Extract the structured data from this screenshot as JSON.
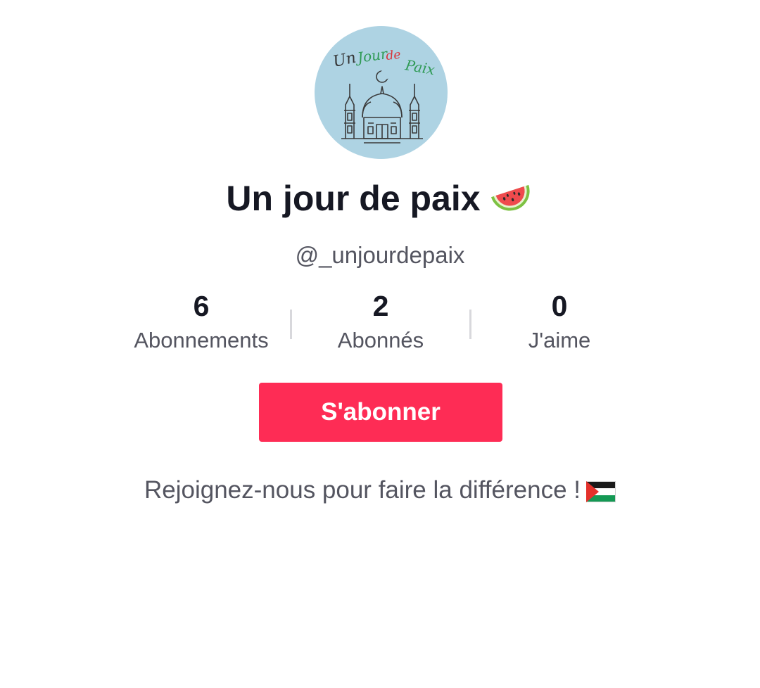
{
  "profile": {
    "avatar_text": "Un Jour de Paix",
    "display_name": "Un jour de paix",
    "display_name_emoji": "watermelon-icon",
    "username": "@_unjourdepaix"
  },
  "stats": [
    {
      "value": "6",
      "label": "Abonnements"
    },
    {
      "value": "2",
      "label": "Abonnés"
    },
    {
      "value": "0",
      "label": "J'aime"
    }
  ],
  "actions": {
    "follow_label": "S'abonner"
  },
  "bio": {
    "text": "Rejoignez-nous pour faire la différence !",
    "emoji": "palestine-flag-icon"
  },
  "colors": {
    "accent": "#fe2c55",
    "avatar_bg": "#aed3e3",
    "text_primary": "#161823",
    "text_secondary": "#545560"
  }
}
